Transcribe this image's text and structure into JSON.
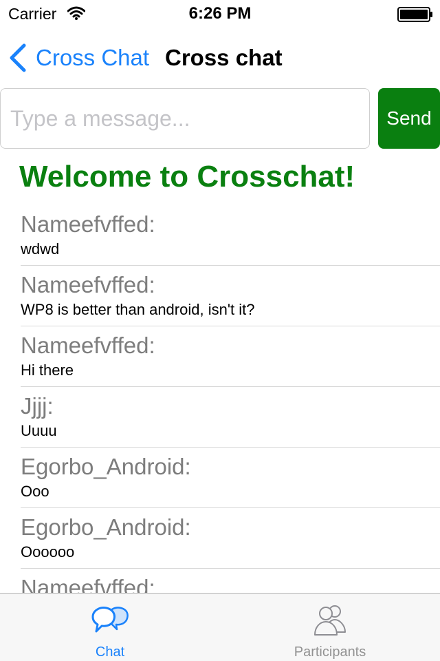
{
  "status_bar": {
    "carrier": "Carrier",
    "time": "6:26 PM"
  },
  "nav": {
    "back_label": "Cross Chat",
    "title": "Cross chat"
  },
  "composer": {
    "placeholder": "Type a message...",
    "send_label": "Send"
  },
  "welcome": "Welcome to Crosschat!",
  "messages": [
    {
      "author": "Nameefvffed:",
      "text": "wdwd"
    },
    {
      "author": "Nameefvffed:",
      "text": "WP8 is better than android, isn't it?"
    },
    {
      "author": "Nameefvffed:",
      "text": "Hi there"
    },
    {
      "author": "Jjjj:",
      "text": "Uuuu"
    },
    {
      "author": "Egorbo_Android:",
      "text": "Ooo"
    },
    {
      "author": "Egorbo_Android:",
      "text": "Oooooo"
    },
    {
      "author": "Nameefvffed:",
      "text": ""
    }
  ],
  "tabs": [
    {
      "label": "Chat",
      "icon": "chat-bubbles-icon",
      "selected": true
    },
    {
      "label": "Participants",
      "icon": "people-icon",
      "selected": false
    }
  ],
  "colors": {
    "accent_blue": "#1a82fb",
    "send_green": "#0a7f10",
    "welcome_green": "#0a8010",
    "author_gray": "#7d7d7d"
  }
}
